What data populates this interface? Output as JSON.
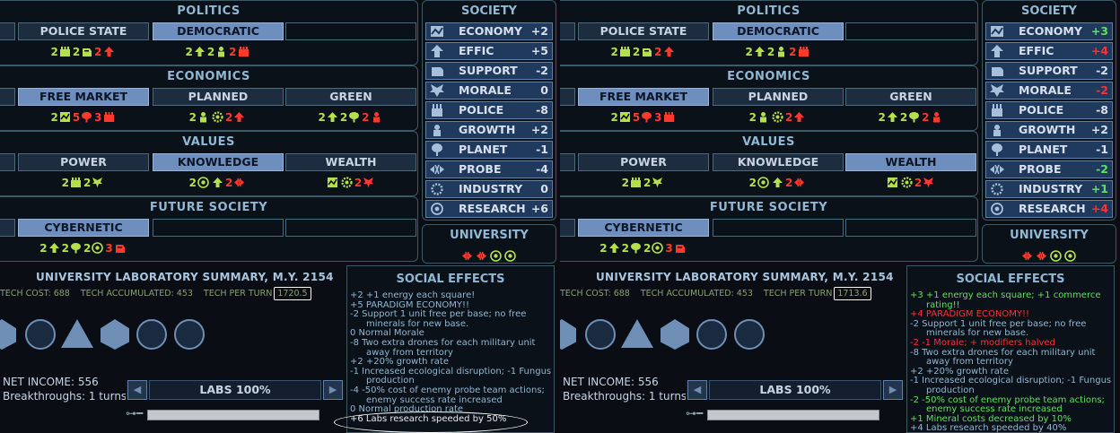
{
  "left": {
    "politics": {
      "title": "POLITICS",
      "choices": [
        "POLICE STATE",
        "DEMOCRATIC",
        ""
      ]
    },
    "economics": {
      "title": "ECONOMICS",
      "choices": [
        "FREE MARKET",
        "PLANNED",
        "GREEN"
      ]
    },
    "values": {
      "title": "VALUES",
      "choices": [
        "POWER",
        "KNOWLEDGE",
        "WEALTH"
      ]
    },
    "future": {
      "title": "FUTURE SOCIETY",
      "choices": [
        "CYBERNETIC",
        "",
        ""
      ]
    },
    "society": {
      "title": "SOCIETY",
      "rows": [
        {
          "label": "ECONOMY",
          "value": "+2",
          "color": "#d6e0ee"
        },
        {
          "label": "EFFIC",
          "value": "+5",
          "color": "#d6e0ee"
        },
        {
          "label": "SUPPORT",
          "value": "-2",
          "color": "#d6e0ee"
        },
        {
          "label": "MORALE",
          "value": "0",
          "color": "#d6e0ee"
        },
        {
          "label": "POLICE",
          "value": "-8",
          "color": "#d6e0ee"
        },
        {
          "label": "GROWTH",
          "value": "+2",
          "color": "#d6e0ee"
        },
        {
          "label": "PLANET",
          "value": "-1",
          "color": "#d6e0ee"
        },
        {
          "label": "PROBE",
          "value": "-4",
          "color": "#d6e0ee"
        },
        {
          "label": "INDUSTRY",
          "value": "0",
          "color": "#d6e0ee"
        },
        {
          "label": "RESEARCH",
          "value": "+6",
          "color": "#d6e0ee"
        }
      ]
    },
    "university": "UNIVERSITY",
    "lab": {
      "title": "UNIVERSITY LABORATORY SUMMARY,  M.Y. 2154",
      "tech_cost": "TECH COST: 688",
      "tech_acc": "TECH ACCUMULATED: 453",
      "tech_per_turn_label": "TECH PER TURN",
      "tech_per_turn": "1720.5",
      "net_income": "NET INCOME: 556",
      "breakthroughs": "Breakthroughs: 1 turns",
      "labs": "LABS 100%"
    },
    "effects_title": "SOCIAL EFFECTS",
    "effects": [
      {
        "t": "+2  +1 energy each square!",
        "c": "n",
        "ind": false
      },
      {
        "t": "+5  PARADIGM ECONOMY!!",
        "c": "n",
        "ind": false
      },
      {
        "t": "-2  Support 1 unit free per base; no free",
        "c": "n",
        "ind": false
      },
      {
        "t": "minerals for new base.",
        "c": "n",
        "ind": true
      },
      {
        "t": " 0  Normal Morale",
        "c": "n",
        "ind": false
      },
      {
        "t": "-8  Two extra drones for each military unit",
        "c": "n",
        "ind": false
      },
      {
        "t": "away from territory",
        "c": "n",
        "ind": true
      },
      {
        "t": "+2  +20% growth rate",
        "c": "n",
        "ind": false
      },
      {
        "t": "-1  Increased ecological disruption; -1 Fungus",
        "c": "n",
        "ind": false
      },
      {
        "t": "production",
        "c": "n",
        "ind": true
      },
      {
        "t": "-4  -50% cost of enemy probe team actions;",
        "c": "n",
        "ind": false
      },
      {
        "t": "enemy success rate increased",
        "c": "n",
        "ind": true
      },
      {
        "t": " 0  Normal production rate",
        "c": "n",
        "ind": false
      },
      {
        "t": "+6  Labs research speeded by 50%",
        "c": "w",
        "ind": false
      }
    ]
  },
  "right": {
    "politics": {
      "title": "POLITICS",
      "choices": [
        "POLICE STATE",
        "DEMOCRATIC",
        ""
      ]
    },
    "economics": {
      "title": "ECONOMICS",
      "choices": [
        "FREE MARKET",
        "PLANNED",
        "GREEN"
      ]
    },
    "values": {
      "title": "VALUES",
      "choices": [
        "POWER",
        "KNOWLEDGE",
        "WEALTH"
      ]
    },
    "future": {
      "title": "FUTURE SOCIETY",
      "choices": [
        "CYBERNETIC",
        "",
        ""
      ]
    },
    "society": {
      "title": "SOCIETY",
      "rows": [
        {
          "label": "ECONOMY",
          "value": "+3",
          "color": "#5fe05f"
        },
        {
          "label": "EFFIC",
          "value": "+4",
          "color": "#ff3030"
        },
        {
          "label": "SUPPORT",
          "value": "-2",
          "color": "#d6e0ee"
        },
        {
          "label": "MORALE",
          "value": "-2",
          "color": "#ff3030"
        },
        {
          "label": "POLICE",
          "value": "-8",
          "color": "#d6e0ee"
        },
        {
          "label": "GROWTH",
          "value": "+2",
          "color": "#d6e0ee"
        },
        {
          "label": "PLANET",
          "value": "-1",
          "color": "#d6e0ee"
        },
        {
          "label": "PROBE",
          "value": "-2",
          "color": "#5fe05f"
        },
        {
          "label": "INDUSTRY",
          "value": "+1",
          "color": "#5fe05f"
        },
        {
          "label": "RESEARCH",
          "value": "+4",
          "color": "#ff3030"
        }
      ]
    },
    "university": "UNIVERSITY",
    "lab": {
      "title": "UNIVERSITY LABORATORY SUMMARY,  M.Y. 2154",
      "tech_cost": "TECH COST: 688",
      "tech_acc": "TECH ACCUMULATED: 453",
      "tech_per_turn_label": "TECH PER TURN",
      "tech_per_turn": "1713.6",
      "net_income": "NET INCOME: 556",
      "breakthroughs": "Breakthroughs: 1 turns",
      "labs": "LABS 100%"
    },
    "effects_title": "SOCIAL EFFECTS",
    "effects": [
      {
        "t": "+3  +1 energy each square; +1 commerce",
        "c": "gr",
        "ind": false
      },
      {
        "t": "rating!!",
        "c": "gr",
        "ind": true
      },
      {
        "t": "+4  PARADIGM ECONOMY!!",
        "c": "rd",
        "ind": false
      },
      {
        "t": "-2  Support 1 unit free per base; no free",
        "c": "n",
        "ind": false
      },
      {
        "t": "minerals for new base.",
        "c": "n",
        "ind": true
      },
      {
        "t": "-2  -1 Morale; + modifiers halved",
        "c": "rd",
        "ind": false
      },
      {
        "t": "-8  Two extra drones for each military unit",
        "c": "n",
        "ind": false
      },
      {
        "t": "away from territory",
        "c": "n",
        "ind": true
      },
      {
        "t": "+2  +20% growth rate",
        "c": "n",
        "ind": false
      },
      {
        "t": "-1  Increased ecological disruption; -1 Fungus",
        "c": "n",
        "ind": false
      },
      {
        "t": "production",
        "c": "n",
        "ind": true
      },
      {
        "t": "-2  -50% cost of enemy probe team actions;",
        "c": "gr",
        "ind": false
      },
      {
        "t": "enemy success rate increased",
        "c": "gr",
        "ind": true
      },
      {
        "t": "+1  Mineral costs decreased by 10%",
        "c": "gr",
        "ind": false
      },
      {
        "t": "+4  Labs research speeded by 40%",
        "c": "n",
        "ind": false
      }
    ]
  },
  "effect_icons": {
    "politics": [
      [
        {
          "n": "2",
          "c": "g",
          "i": "police-icon"
        },
        {
          "n": "2",
          "c": "g",
          "i": "support-icon"
        },
        {
          "n": "2",
          "c": "r",
          "i": "effic-icon"
        }
      ],
      [
        {
          "n": "2",
          "c": "g",
          "i": "effic-icon"
        },
        {
          "n": "2",
          "c": "g",
          "i": "growth-icon"
        },
        {
          "n": "2",
          "c": "r",
          "i": "police-icon"
        }
      ],
      []
    ],
    "economics": [
      [
        {
          "n": "2",
          "c": "g",
          "i": "economy-icon"
        },
        {
          "n": "5",
          "c": "r",
          "i": "planet-icon"
        },
        {
          "n": "3",
          "c": "r",
          "i": "police-icon"
        }
      ],
      [
        {
          "n": "2",
          "c": "g",
          "i": "growth-icon"
        },
        {
          "n": "",
          "c": "g",
          "i": "industry-icon"
        },
        {
          "n": "2",
          "c": "r",
          "i": "effic-icon"
        }
      ],
      [
        {
          "n": "2",
          "c": "g",
          "i": "effic-icon"
        },
        {
          "n": "2",
          "c": "g",
          "i": "planet-icon"
        },
        {
          "n": "2",
          "c": "r",
          "i": "growth-icon"
        }
      ]
    ],
    "values": [
      [
        {
          "n": "2",
          "c": "g",
          "i": "police-icon"
        },
        {
          "n": "2",
          "c": "g",
          "i": "morale-icon"
        }
      ],
      [
        {
          "n": "2",
          "c": "g",
          "i": "research-icon"
        },
        {
          "n": "",
          "c": "g",
          "i": "effic-icon"
        },
        {
          "n": "2",
          "c": "r",
          "i": "probe-icon"
        }
      ],
      [
        {
          "n": "",
          "c": "g",
          "i": "economy-icon"
        },
        {
          "n": "",
          "c": "g",
          "i": "industry-icon"
        },
        {
          "n": "2",
          "c": "r",
          "i": "morale-icon"
        }
      ]
    ],
    "future": [
      [
        {
          "n": "2",
          "c": "g",
          "i": "effic-icon"
        },
        {
          "n": "2",
          "c": "g",
          "i": "planet-icon"
        },
        {
          "n": "2",
          "c": "g",
          "i": "research-icon"
        },
        {
          "n": "3",
          "c": "r",
          "i": "support-icon"
        }
      ],
      [],
      []
    ]
  },
  "selected": {
    "left": {
      "politics": 1,
      "economics": 0,
      "values": 1,
      "future": 0
    },
    "right": {
      "politics": 1,
      "economics": 0,
      "values": 2,
      "future": 0
    }
  },
  "colors": {
    "accent": "#6e8fbe",
    "positive": "#5fe05f",
    "negative": "#ff3030",
    "frame": "#3a5a6a"
  }
}
